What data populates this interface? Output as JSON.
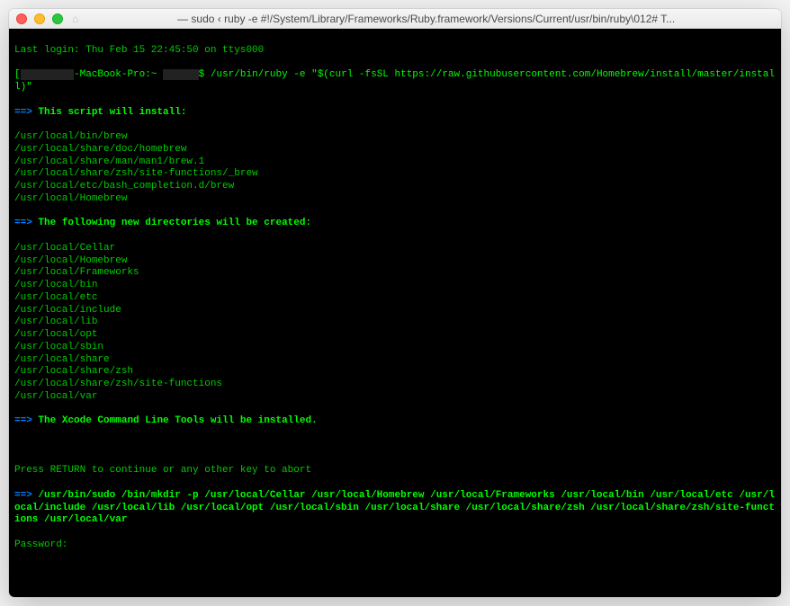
{
  "titlebar": {
    "title": "— sudo ‹ ruby -e #!/System/Library/Frameworks/Ruby.framework/Versions/Current/usr/bin/ruby\\012# T..."
  },
  "term": {
    "last_login": "Last login: Thu Feb 15 22:45:50 on ttys000",
    "prompt_host": "-MacBook-Pro:~ ",
    "prompt_cmd": "$ /usr/bin/ruby -e \"$(curl -fsSL https://raw.githubusercontent.com/Homebrew/install/master/install)\"",
    "arrow": "==>",
    "script_install": "This script will install:",
    "install_paths": [
      "/usr/local/bin/brew",
      "/usr/local/share/doc/homebrew",
      "/usr/local/share/man/man1/brew.1",
      "/usr/local/share/zsh/site-functions/_brew",
      "/usr/local/etc/bash_completion.d/brew",
      "/usr/local/Homebrew"
    ],
    "new_dirs": "The following new directories will be created:",
    "dir_paths": [
      "/usr/local/Cellar",
      "/usr/local/Homebrew",
      "/usr/local/Frameworks",
      "/usr/local/bin",
      "/usr/local/etc",
      "/usr/local/include",
      "/usr/local/lib",
      "/usr/local/opt",
      "/usr/local/sbin",
      "/usr/local/share",
      "/usr/local/share/zsh",
      "/usr/local/share/zsh/site-functions",
      "/usr/local/var"
    ],
    "xcode": "The Xcode Command Line Tools will be installed.",
    "press_return": "Press RETURN to continue or any other key to abort",
    "mkdir_cmd": "/usr/bin/sudo /bin/mkdir -p /usr/local/Cellar /usr/local/Homebrew /usr/local/Frameworks /usr/local/bin /usr/local/etc /usr/local/include /usr/local/lib /usr/local/opt /usr/local/sbin /usr/local/share /usr/local/share/zsh /usr/local/share/zsh/site-functions /usr/local/var",
    "password": "Password:"
  }
}
